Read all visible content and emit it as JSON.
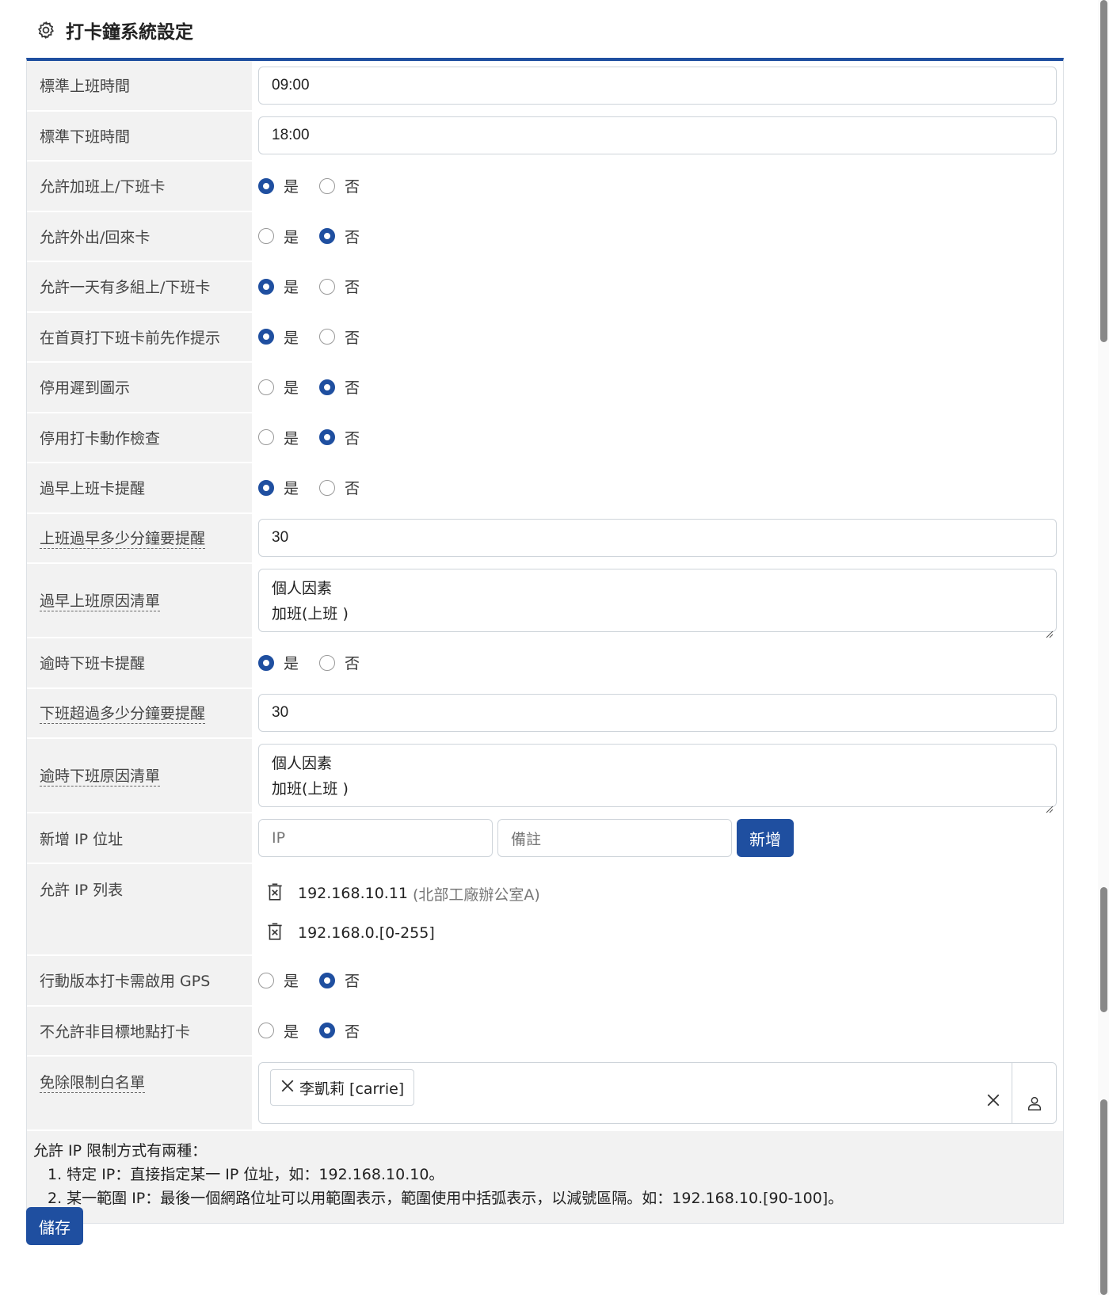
{
  "page": {
    "title": "打卡鐘系統設定"
  },
  "options": {
    "yes": "是",
    "no": "否"
  },
  "rows": [
    {
      "label": "標準上班時間",
      "type": "input",
      "value": "09:00"
    },
    {
      "label": "標準下班時間",
      "type": "input",
      "value": "18:00"
    },
    {
      "label": "允許加班上/下班卡",
      "type": "radio",
      "selected": "yes"
    },
    {
      "label": "允許外出/回來卡",
      "type": "radio",
      "selected": "no"
    },
    {
      "label": "允許一天有多組上/下班卡",
      "type": "radio",
      "selected": "yes"
    },
    {
      "label": "在首頁打下班卡前先作提示",
      "type": "radio",
      "selected": "yes"
    },
    {
      "label": "停用遲到圖示",
      "type": "radio",
      "selected": "no"
    },
    {
      "label": "停用打卡動作檢查",
      "type": "radio",
      "selected": "no"
    },
    {
      "label": "過早上班卡提醒",
      "type": "radio",
      "selected": "yes"
    },
    {
      "label": "上班過早多少分鐘要提醒",
      "type": "input",
      "value": "30",
      "dotted": true
    },
    {
      "label": "過早上班原因清單",
      "type": "textarea",
      "lines": [
        "個人因素",
        "加班(上班 )"
      ],
      "dotted": true
    },
    {
      "label": "逾時下班卡提醒",
      "type": "radio",
      "selected": "yes"
    },
    {
      "label": "下班超過多少分鐘要提醒",
      "type": "input",
      "value": "30",
      "dotted": true
    },
    {
      "label": "逾時下班原因清單",
      "type": "textarea",
      "lines": [
        "個人因素",
        "加班(上班 )"
      ],
      "dotted": true
    }
  ],
  "add_ip": {
    "label": "新增 IP 位址",
    "ip_placeholder": "IP",
    "note_placeholder": "備註",
    "add_button": "新增"
  },
  "ip_list": {
    "label": "允許 IP 列表",
    "items": [
      {
        "ip": "192.168.10.11",
        "note": "(北部工廠辦公室A)"
      },
      {
        "ip": "192.168.0.[0-255]",
        "note": ""
      }
    ]
  },
  "rows2": [
    {
      "label": "行動版本打卡需啟用 GPS",
      "type": "radio",
      "selected": "no"
    },
    {
      "label": "不允許非目標地點打卡",
      "type": "radio",
      "selected": "no"
    }
  ],
  "whitelist": {
    "label": "免除限制白名單",
    "tags": [
      "李凱莉 [carrie]"
    ]
  },
  "note": {
    "title": "允許 IP 限制方式有兩種：",
    "lines": [
      "1. 特定 IP：直接指定某一 IP 位址，如：192.168.10.10。",
      "2. 某一範圍 IP：最後一個網路位址可以用範圍表示，範圍使用中括弧表示，以減號區隔。如：192.168.10.[90-100]。"
    ]
  },
  "save_button": "儲存"
}
